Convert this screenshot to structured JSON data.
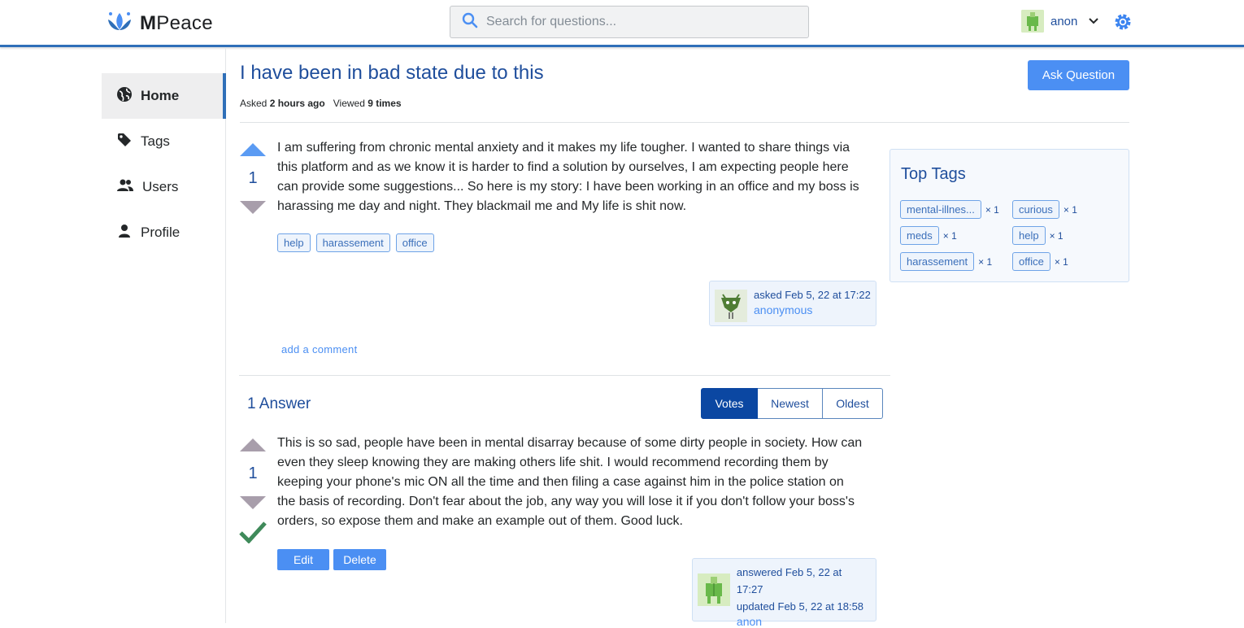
{
  "app": {
    "brand": "Peace",
    "brand_initial": "M"
  },
  "search": {
    "placeholder": "Search for questions..."
  },
  "user": {
    "name": "anon"
  },
  "sidebar": {
    "items": [
      {
        "label": "Home",
        "icon": "globe-icon",
        "active": true
      },
      {
        "label": "Tags",
        "icon": "tag-icon"
      },
      {
        "label": "Users",
        "icon": "users-icon"
      },
      {
        "label": "Profile",
        "icon": "person-icon"
      }
    ]
  },
  "question": {
    "title": "I have been in bad state due to this",
    "asked_label": "Asked",
    "asked_value": "2 hours ago",
    "viewed_label": "Viewed",
    "viewed_value": "9 times",
    "votes": "1",
    "body_lines": [
      "I am suffering from chronic mental anxiety and it makes my life tougher. I wanted to share things via",
      "this platform and as we know it is harder to find a solution by ourselves, I am expecting people here",
      "can provide some suggestions... So here is my story: I have been working in an office and my boss is",
      "harassing me day and night. They blackmail me and My life is shit now."
    ],
    "tags": [
      "help",
      "harassement",
      "office"
    ],
    "asked_on": "asked Feb 5, 22 at 17:22",
    "author": "anonymous",
    "add_comment": "add a comment"
  },
  "ask_button": "Ask Question",
  "answers": {
    "title": "1 Answer",
    "sort_options": [
      "Votes",
      "Newest",
      "Oldest"
    ],
    "items": [
      {
        "votes": "1",
        "accepted": true,
        "body_lines": [
          "This is so sad, people have been in mental disarray because of some dirty people in society. How can",
          "even they sleep knowing they are making others life shit. I would recommend recording them by",
          "keeping your phone's mic ON all the time and then filing a case against him in the police station on",
          "the basis of recording. Don't fear about the job, any way you will lose it if you don't follow your boss's",
          "orders, so expose them and make an example out of them. Good luck."
        ],
        "edit_label": "Edit",
        "delete_label": "Delete",
        "answered_on": "answered Feb 5, 22 at 17:27",
        "updated_on": "updated Feb 5, 22 at 18:58",
        "author": "anon"
      }
    ]
  },
  "top_tags": {
    "title": "Top Tags",
    "items": [
      {
        "name": "mental-illnes...",
        "count": "× 1"
      },
      {
        "name": "curious",
        "count": "× 1"
      },
      {
        "name": "meds",
        "count": "× 1"
      },
      {
        "name": "help",
        "count": "× 1"
      },
      {
        "name": "harassement",
        "count": "× 1"
      },
      {
        "name": "office",
        "count": "× 1"
      }
    ]
  },
  "colors": {
    "primary": "#4b8ff3",
    "link": "#1f4e9c",
    "accent_bar": "#2f6fb8",
    "accepted": "#3f8a5a",
    "sort_active": "#0b47a2"
  }
}
